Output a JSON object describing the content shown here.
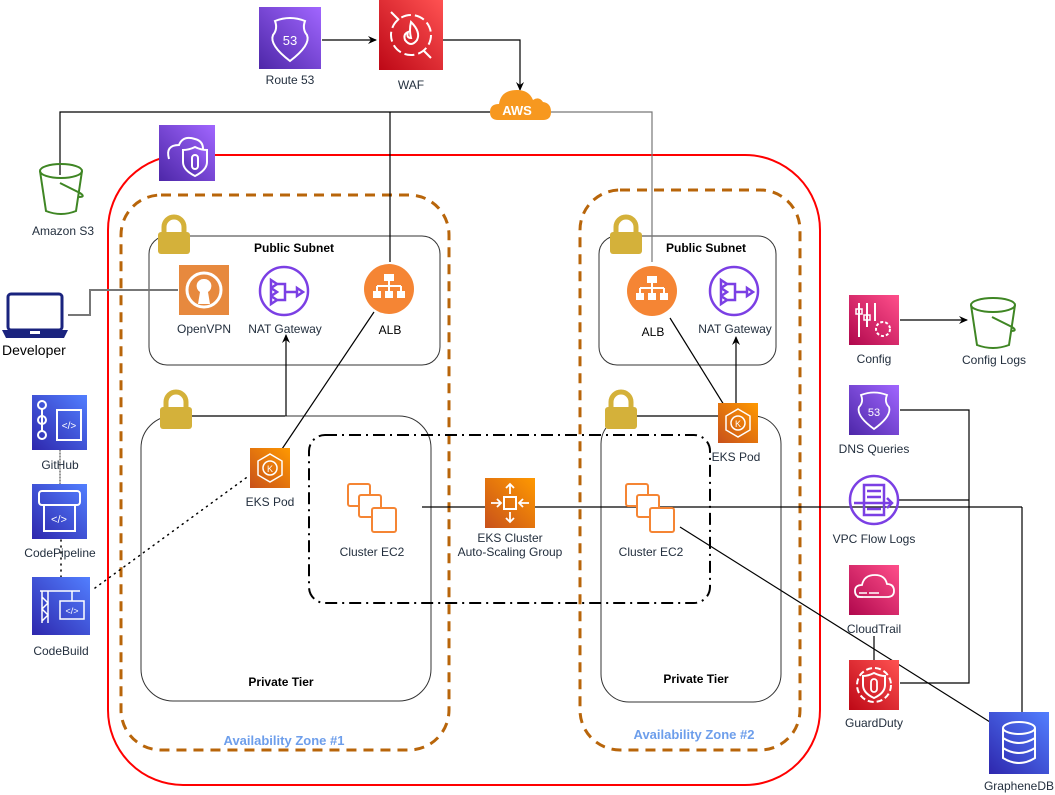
{
  "diagram": {
    "type": "aws-architecture",
    "external": {
      "route53": {
        "label": "Route 53"
      },
      "waf": {
        "label": "WAF"
      },
      "aws_cloud": {
        "label": "AWS"
      },
      "s3": {
        "label": "Amazon S3"
      },
      "developer": {
        "label": "Developer"
      }
    },
    "cicd": {
      "github": {
        "label": "GitHub"
      },
      "codepipeline": {
        "label": "CodePipeline"
      },
      "codebuild": {
        "label": "CodeBuild"
      }
    },
    "az1": {
      "label": "Availability Zone #1",
      "public_subnet": {
        "label": "Public  Subnet",
        "openvpn": "OpenVPN",
        "nat": "NAT Gateway",
        "alb": "ALB"
      },
      "private_tier": {
        "label": "Private Tier",
        "eks_pod": "EKS Pod",
        "cluster_ec2": "Cluster EC2"
      }
    },
    "az2": {
      "label": "Availability Zone #2",
      "public_subnet": {
        "label": "Public Subnet",
        "alb": "ALB",
        "nat": "NAT Gateway"
      },
      "private_tier": {
        "label": "Private Tier",
        "eks_pod": "EKS Pod",
        "cluster_ec2": "Cluster EC2"
      }
    },
    "asg": {
      "line1": "EKS Cluster",
      "line2": "Auto-Scaling Group"
    },
    "monitoring": {
      "config": "Config",
      "config_logs": "Config Logs",
      "dns_queries": "DNS Queries",
      "vpc_flow_logs": "VPC Flow Logs",
      "cloudtrail": "CloudTrail",
      "guardduty": "GuardDuty",
      "graphenedb": "GrapheneDB"
    },
    "colors": {
      "vpc_border": "#ff0000",
      "az_border": "#b8650a",
      "az_label": "#6d9eeb",
      "lock": "#d4b13a",
      "orange": "#ed7100",
      "purple": "#7b3fe4",
      "red": "#dd344c",
      "pink": "#e7157b",
      "blue": "#3b48cc",
      "green": "#3f8624"
    }
  }
}
